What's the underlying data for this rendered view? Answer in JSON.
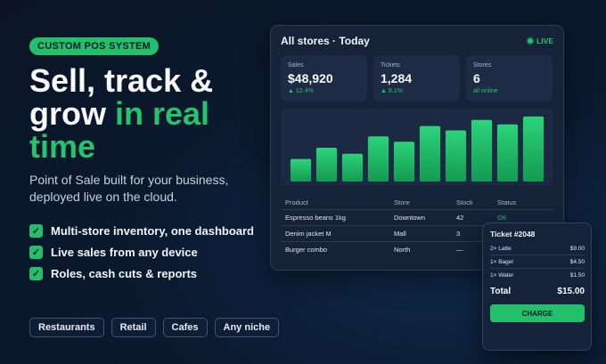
{
  "hero": {
    "badge": "CUSTOM POS SYSTEM",
    "headline_line1": "Sell, track &",
    "headline_line2_plain": "grow ",
    "headline_line2_accent": "in real",
    "headline_line3_accent": "time",
    "subtitle": "Point of Sale built for your business, deployed live on the cloud.",
    "features": [
      "Multi-store inventory, one dashboard",
      "Live sales from any device",
      "Roles, cash cuts & reports"
    ],
    "tags": [
      "Restaurants",
      "Retail",
      "Cafes",
      "Any niche"
    ]
  },
  "dashboard": {
    "title": "All stores · Today",
    "live_label": "LIVE",
    "stats": [
      {
        "label": "Sales",
        "value": "$48,920",
        "delta": "▲ 12.4%"
      },
      {
        "label": "Tickets",
        "value": "1,284",
        "delta": "▲ 8.1%"
      },
      {
        "label": "Stores",
        "value": "6",
        "delta": "all online"
      }
    ],
    "table": {
      "headers": [
        "Product",
        "Store",
        "Stock",
        "Status"
      ],
      "rows": [
        [
          "Espresso beans 1kg",
          "Downtown",
          "42",
          "OK"
        ],
        [
          "Denim jacket M",
          "Mall",
          "3",
          ""
        ],
        [
          "Burger combo",
          "North",
          "—",
          ""
        ]
      ]
    }
  },
  "chart_data": {
    "type": "bar",
    "categories": [
      "",
      "",
      "",
      "",
      "",
      "",
      "",
      "",
      "",
      "",
      ""
    ],
    "values": [
      26,
      39,
      32,
      52,
      46,
      64,
      59,
      71,
      66,
      75,
      0
    ],
    "ylim": [
      0,
      80
    ],
    "bar_color": "#22c06a",
    "grid": false,
    "note_bar_count": 10
  },
  "ticket": {
    "title": "Ticket #2048",
    "items": [
      {
        "name": "2× Latte",
        "price": "$9.00"
      },
      {
        "name": "1× Bagel",
        "price": "$4.50"
      },
      {
        "name": "1× Water",
        "price": "$1.50"
      }
    ],
    "total_label": "Total",
    "total_value": "$15.00",
    "charge_label": "CHARGE"
  },
  "colors": {
    "accent": "#22c06a",
    "background": "#0b1a30",
    "panel": "#152238"
  }
}
